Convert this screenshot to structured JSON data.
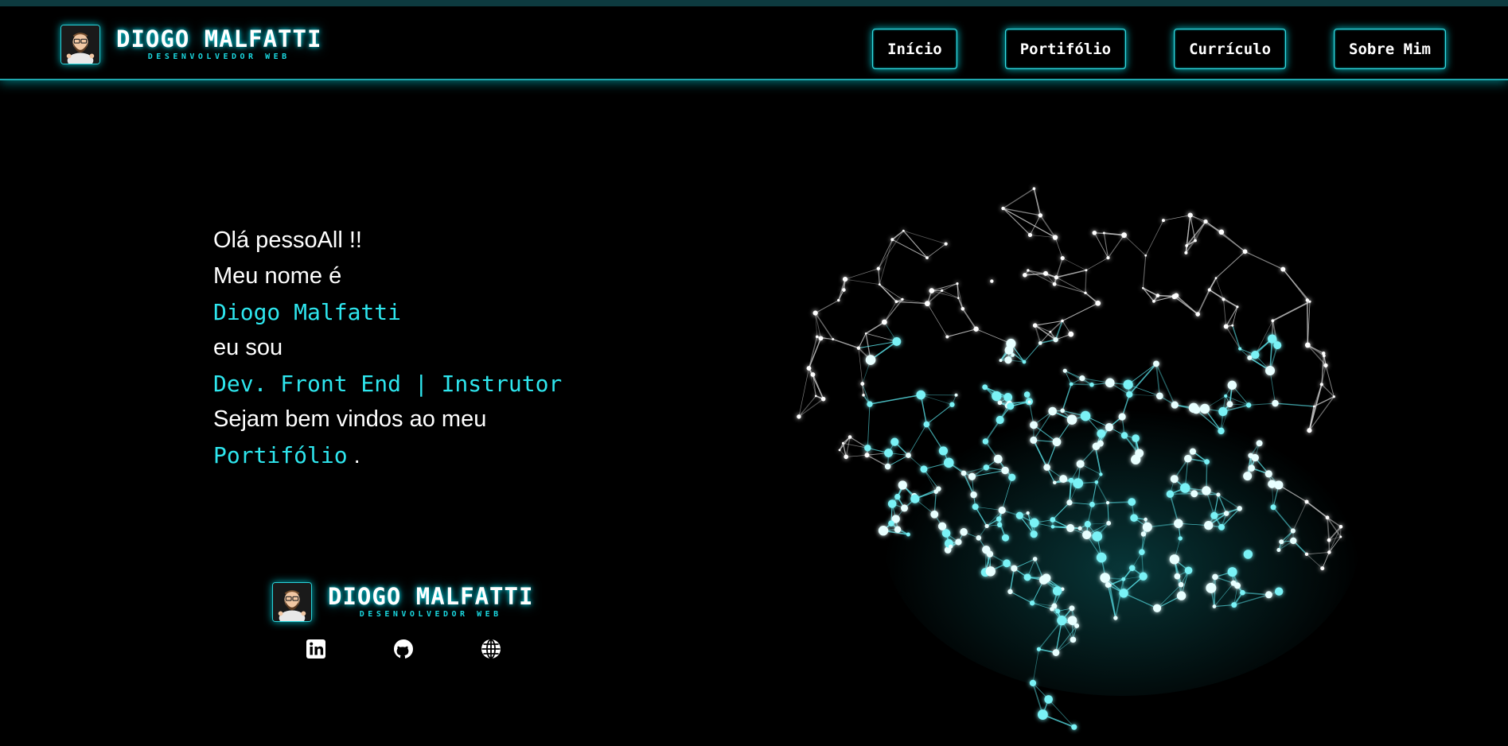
{
  "header": {
    "brand": {
      "name": "DIOGO MALFATTI",
      "subtitle": "DESENVOLVEDOR WEB",
      "avatar_icon": "memoji-avatar-icon"
    },
    "nav": [
      {
        "label": "Início"
      },
      {
        "label": "Portifólio"
      },
      {
        "label": "Currículo"
      },
      {
        "label": "Sobre Mim"
      }
    ]
  },
  "hero": {
    "greeting": "Olá pessoAll !!",
    "name_intro": "Meu nome é",
    "name": "Diogo Malfatti",
    "role_intro": "eu sou",
    "role": "Dev. Front End | Instrutor",
    "welcome": "Sejam bem vindos ao meu",
    "portfolio_word": "Portifólio",
    "end_punct": "."
  },
  "footer_brand": {
    "name": "DIOGO MALFATTI",
    "subtitle": "DESENVOLVEDOR WEB"
  },
  "socials": [
    {
      "icon": "linkedin-icon"
    },
    {
      "icon": "github-icon"
    },
    {
      "icon": "globe-icon"
    }
  ],
  "colors": {
    "background": "#000000",
    "accent": "#2ee6ee",
    "glow": "#00e0f0",
    "text": "#ffffff"
  },
  "illustration": {
    "icon": "brain-network-icon"
  }
}
